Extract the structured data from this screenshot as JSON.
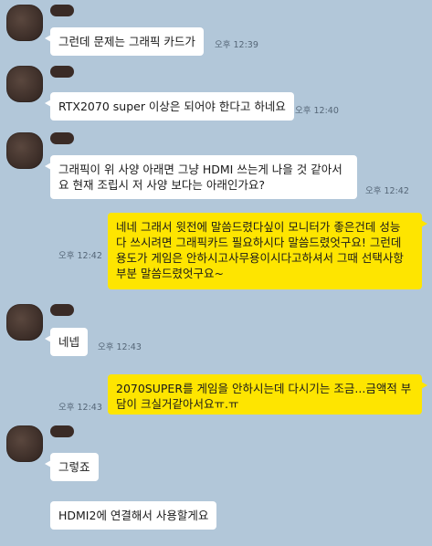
{
  "messages": [
    {
      "text": "그런데 문제는 그래픽 카드가",
      "time": "오후 12:39"
    },
    {
      "text": "RTX2070 super 이상은 되어야 한다고 하네요",
      "time": "오후 12:40"
    },
    {
      "lines": [
        "그래픽이 위 사양 아래면 그냥 HDMI 쓰는게 나을 것 같아서",
        "요 현재 조립시 저 사양 보다는 아래인가요?"
      ],
      "time": "오후 12:42"
    },
    {
      "lines": [
        "네네 그래서 윗전에 말씀드렸다싶이 모니터가 좋은건데 성능",
        "다 쓰시려면 그래픽카드 필요하시다 말씀드렸엇구요! 그런데",
        "용도가 게임은 안하시고사무용이시다고하셔서 그때 선택사항",
        "부분 말씀드렸엇구요~"
      ],
      "time": "오후 12:42"
    },
    {
      "text": "네넵",
      "time": "오후 12:43"
    },
    {
      "lines": [
        "2070SUPER를 게임을 안하시는데 다시기는 조금...금액적 부",
        "담이 크실거같아서요ㅠ.ㅠ"
      ],
      "time": "오후 12:43"
    },
    {
      "text": "그렇죠"
    },
    {
      "text": "HDMI2에 연결해서 사용할게요"
    }
  ]
}
